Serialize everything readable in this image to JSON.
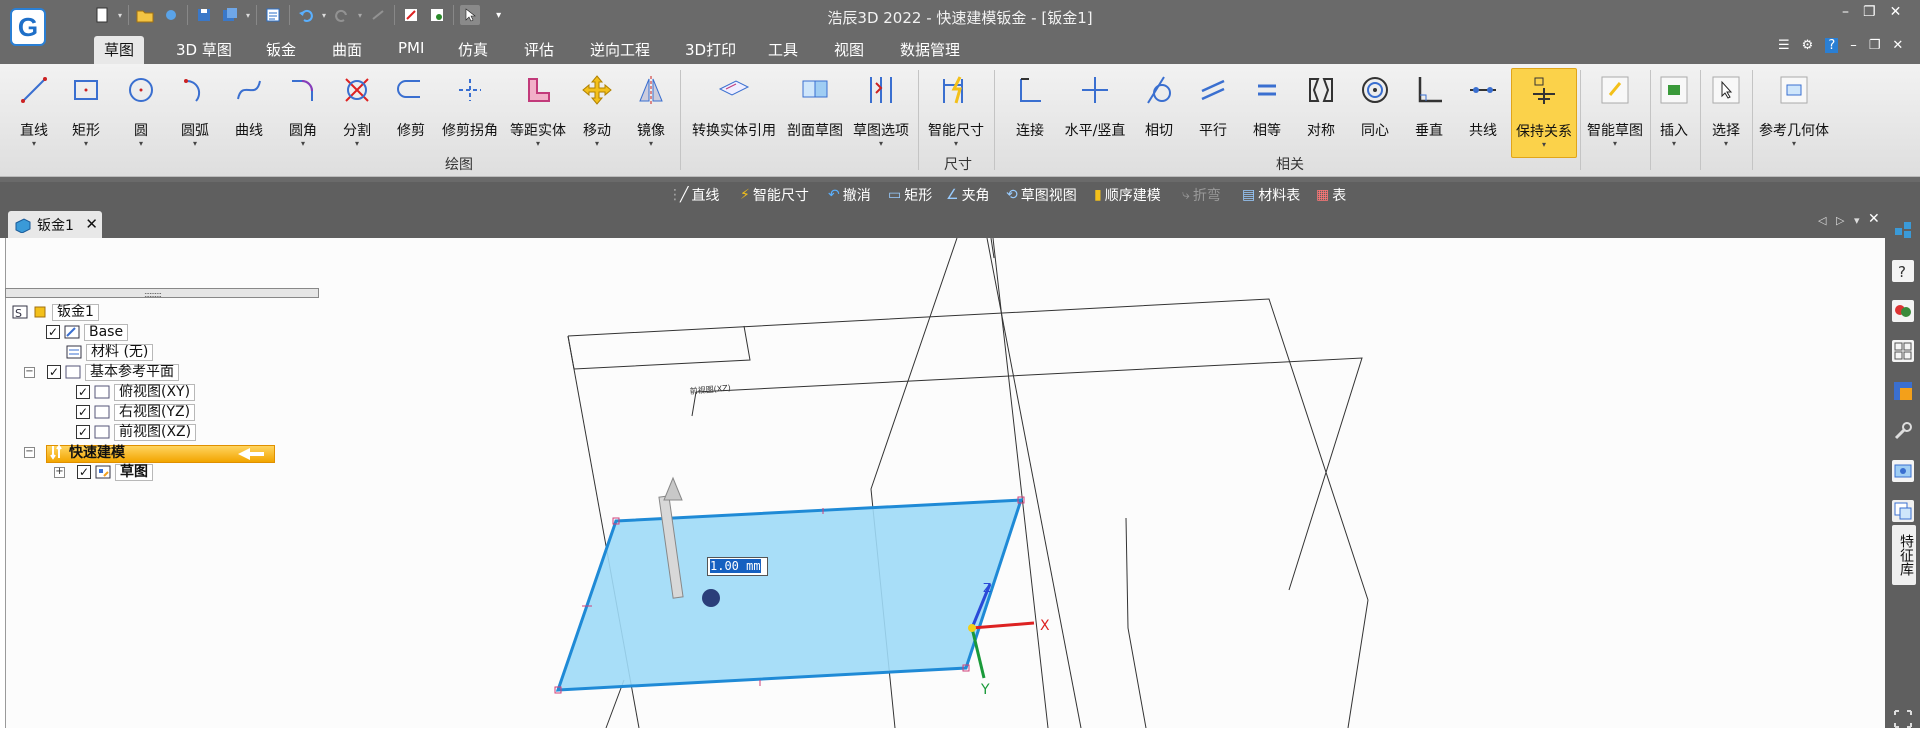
{
  "window": {
    "title": "浩辰3D 2022 - 快速建模钣金 - [钣金1]",
    "logo": "G"
  },
  "window_controls": [
    "–",
    "❐",
    "✕"
  ],
  "ribbon_window_controls": [
    "☰",
    "⚙",
    "?",
    "–",
    "❐",
    "✕"
  ],
  "tabs": [
    "草图",
    "3D 草图",
    "钣金",
    "曲面",
    "PMI",
    "仿真",
    "评估",
    "逆向工程",
    "3D打印",
    "工具",
    "视图",
    "数据管理"
  ],
  "ribbon": {
    "draw": [
      "直线",
      "矩形",
      "圆",
      "圆弧",
      "曲线",
      "圆角",
      "分割",
      "修剪",
      "修剪拐角",
      "等距实体",
      "移动",
      "镜像"
    ],
    "draw_group": "绘图",
    "convert": [
      "转换实体引用",
      "剖面草图",
      "草图选项"
    ],
    "dim": "智能尺寸",
    "dim_group": "尺寸",
    "relations": [
      "连接",
      "水平/竖直",
      "相切",
      "平行",
      "相等",
      "对称",
      "同心",
      "垂直",
      "共线",
      "保持关系"
    ],
    "rel_group": "相关",
    "extra": [
      "智能草图",
      "插入",
      "选择",
      "参考几何体"
    ]
  },
  "sketchbar": [
    "直线",
    "智能尺寸",
    "撤消",
    "矩形",
    "夹角",
    "草图视图",
    "顺序建模",
    "折弯",
    "材料表",
    "表"
  ],
  "document_tab": "钣金1",
  "doc_nav": [
    "◁",
    "▷",
    "▾",
    "✕"
  ],
  "tree": {
    "root": "钣金1",
    "base": "Base",
    "material": "材料 (无)",
    "ref_planes": "基本参考平面",
    "plane_xy": "俯视图(XY)",
    "plane_yz": "右视图(YZ)",
    "plane_xz": "前视图(XZ)",
    "rapid": "快速建模",
    "sketch": "草图",
    "check": "✓",
    "collapse": "−",
    "expand": "+"
  },
  "viewport": {
    "dimension": "1.00 mm",
    "plane_label": "前视图(XZ)",
    "axis_x": "X",
    "axis_y": "Y",
    "axis_z": "Z"
  },
  "right_panel": {
    "feature_library": "特征库"
  },
  "colors": {
    "accent": "#2a7fd4",
    "highlight": "#fbd24a",
    "sketch_fill": "#9fdaf7",
    "sketch_edge": "#1f8ad6"
  }
}
